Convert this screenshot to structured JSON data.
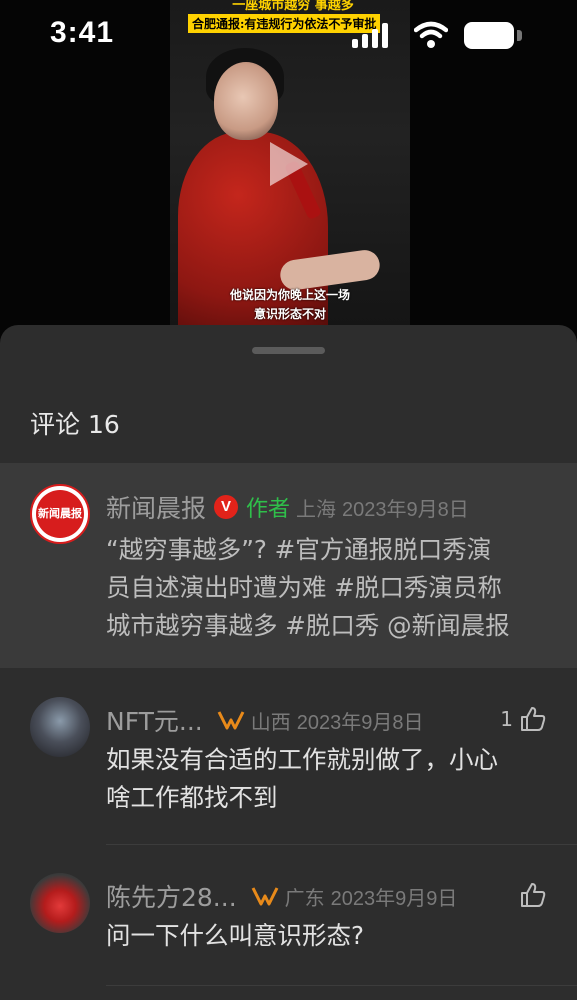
{
  "status_bar": {
    "time": "3:41"
  },
  "video": {
    "headline_top": "一座城市越穷 事越多",
    "headline_banner": "合肥通报:有违规行为依法不予审批",
    "subtitle_line1": "他说因为你晚上这一场",
    "subtitle_line2": "意识形态不对"
  },
  "comments_header": {
    "title": "评论 16"
  },
  "author_post": {
    "avatar_text": "新闻晨报",
    "username": "新闻晨报",
    "verified_badge": "V",
    "author_tag": "作者",
    "location": "上海",
    "date": "2023年9月8日",
    "line1": "“越穷事越多”? #官方通报脱口秀演",
    "line2": "员自述演出时遭为难 #脱口秀演员称",
    "line3": "城市越穷事越多 #脱口秀 @新闻晨报"
  },
  "comments": [
    {
      "username": "NFT元...",
      "location": "山西",
      "date": "2023年9月8日",
      "likes": "1",
      "line1": "如果没有合适的工作就别做了，小心",
      "line2": "啥工作都找不到"
    },
    {
      "username": "陈先方28...",
      "location": "广东",
      "date": "2023年9月9日",
      "likes": "",
      "line1": "问一下什么叫意识形态?"
    }
  ],
  "colors": {
    "sheet_bg": "#2d2d2d",
    "author_block_bg": "#3a3a3a",
    "author_tag": "#2fbf4a",
    "verified_red": "#e2231a",
    "fan_badge_orange": "#e88a1a"
  },
  "icons": [
    "play-icon",
    "signal-icon",
    "wifi-icon",
    "battery-icon",
    "verified-icon",
    "fan-badge-icon",
    "like-icon"
  ]
}
